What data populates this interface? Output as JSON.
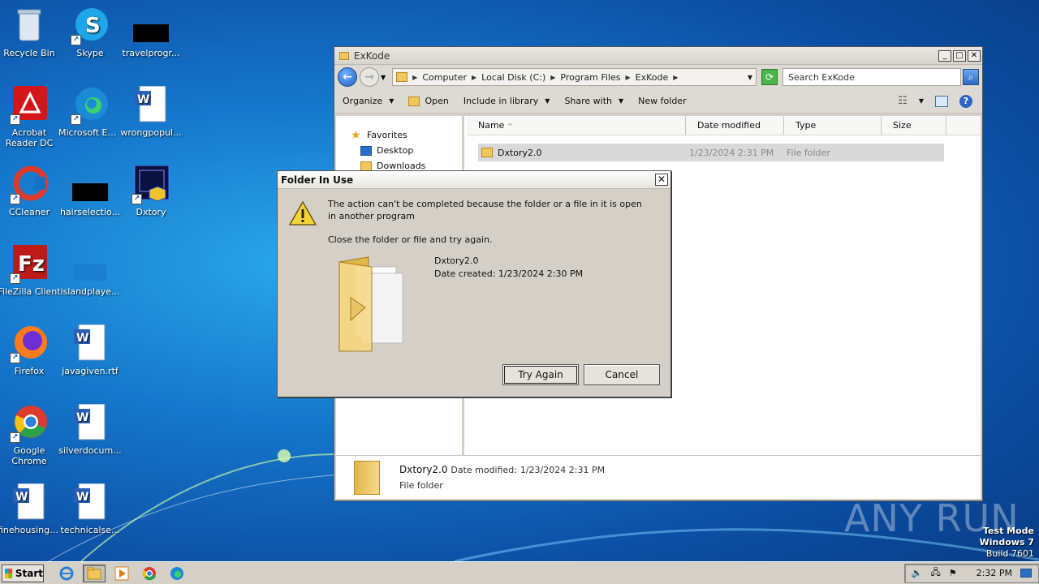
{
  "desktop": {
    "icons": [
      {
        "label": "Recycle Bin"
      },
      {
        "label": "Skype"
      },
      {
        "label": "travelprogr..."
      },
      {
        "label": "Acrobat Reader DC"
      },
      {
        "label": "Microsoft Edge"
      },
      {
        "label": "wrongpopul..."
      },
      {
        "label": "CCleaner"
      },
      {
        "label": "hairselectio..."
      },
      {
        "label": "Dxtory"
      },
      {
        "label": "FileZilla Client"
      },
      {
        "label": "islandplaye..."
      },
      {
        "label": "Firefox"
      },
      {
        "label": "javagiven.rtf"
      },
      {
        "label": "Google Chrome"
      },
      {
        "label": "silverdocum..."
      },
      {
        "label": "finehousing.rtf"
      },
      {
        "label": "technicalse..."
      }
    ]
  },
  "explorer": {
    "title": "ExKode",
    "address": [
      "Computer",
      "Local Disk (C:)",
      "Program Files",
      "ExKode"
    ],
    "search_placeholder": "Search ExKode",
    "commands": {
      "organize": "Organize",
      "open": "Open",
      "include": "Include in library",
      "share": "Share with",
      "new_folder": "New folder"
    },
    "nav": {
      "favorites": "Favorites",
      "desktop": "Desktop",
      "downloads": "Downloads"
    },
    "columns": {
      "name": "Name",
      "date": "Date modified",
      "type": "Type",
      "size": "Size"
    },
    "row": {
      "name": "Dxtory2.0",
      "date": "1/23/2024 2:31 PM",
      "type": "File folder"
    },
    "details": {
      "name": "Dxtory2.0",
      "date_label": "Date modified:",
      "date": "1/23/2024 2:31 PM",
      "type": "File folder"
    }
  },
  "dialog": {
    "title": "Folder In Use",
    "message": "The action can't be completed because the folder or a file in it is open in another program",
    "instruction": "Close the folder or file and try again.",
    "item_name": "Dxtory2.0",
    "item_date": "Date created: 1/23/2024 2:30 PM",
    "try_again": "Try Again",
    "cancel": "Cancel"
  },
  "watermark": {
    "text": "ANY RUN"
  },
  "system": {
    "line1": "Test Mode",
    "line2": "Windows 7",
    "line3": "Build 7601"
  },
  "taskbar": {
    "start": "Start",
    "clock": "2:32 PM"
  }
}
